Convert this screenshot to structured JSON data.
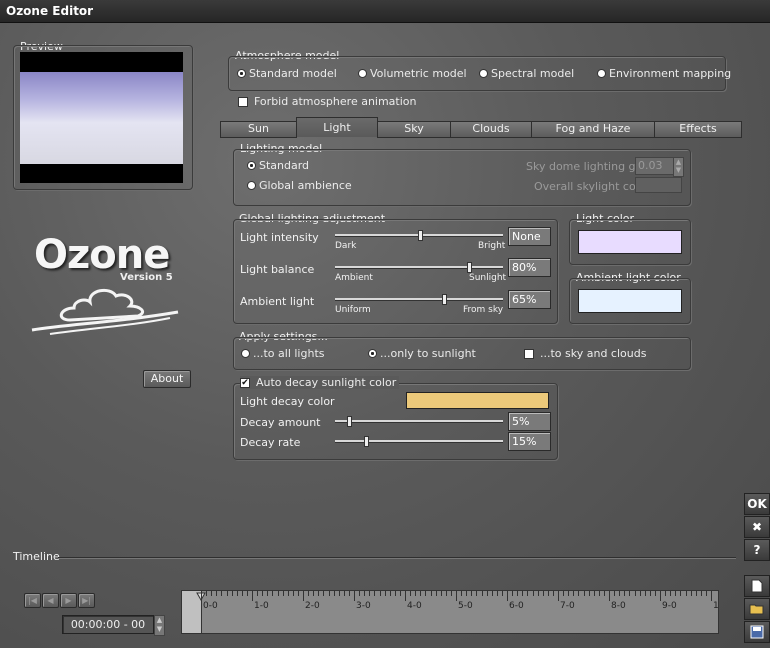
{
  "window": {
    "title": "Ozone Editor"
  },
  "preview": {
    "label": "Preview"
  },
  "logo": {
    "name": "Ozone",
    "version": "Version 5"
  },
  "about_label": "About",
  "atmosphere": {
    "label": "Atmosphere model",
    "options": [
      "Standard model",
      "Volumetric model",
      "Spectral model",
      "Environment mapping"
    ],
    "selected": 0,
    "forbid_label": "Forbid atmosphere animation",
    "forbid_checked": false
  },
  "tabs": [
    "Sun",
    "Light",
    "Sky",
    "Clouds",
    "Fog and Haze",
    "Effects"
  ],
  "active_tab": 1,
  "lighting_model": {
    "label": "Lighting model",
    "options": [
      "Standard",
      "Global ambience"
    ],
    "selected": 0,
    "sky_gain_label": "Sky dome lighting gain",
    "sky_gain_value": "0.03",
    "overall_skylight_label": "Overall skylight color"
  },
  "global_lighting": {
    "label": "Global lighting adjustment",
    "rows": [
      {
        "label": "Light intensity",
        "min_label": "Dark",
        "max_label": "Bright",
        "value": "None",
        "level": 0.5
      },
      {
        "label": "Light balance",
        "min_label": "Ambient",
        "max_label": "Sunlight",
        "value": "80%",
        "level": 0.8
      },
      {
        "label": "Ambient light",
        "min_label": "Uniform",
        "max_label": "From sky",
        "value": "65%",
        "level": 0.65
      }
    ]
  },
  "light_color": {
    "label": "Light color",
    "color": "#e8dcff"
  },
  "ambient_color": {
    "label": "Ambient light color",
    "color": "#e6f2ff"
  },
  "apply": {
    "label": "Apply settings...",
    "options": [
      "...to all lights",
      "...only to sunlight",
      "...to sky and clouds"
    ],
    "selected": 1
  },
  "decay": {
    "auto_label": "Auto decay sunlight color",
    "auto_checked": true,
    "color_label": "Light decay color",
    "color": "#ecc97a",
    "amount_label": "Decay amount",
    "amount_value": "5%",
    "amount_level": 0.05,
    "rate_label": "Decay rate",
    "rate_value": "15%",
    "rate_level": 0.15
  },
  "side_buttons": {
    "ok": "OK",
    "close": "✖",
    "help": "?"
  },
  "timeline": {
    "label": "Timeline",
    "time": "00:00:00 - 00",
    "ticks": [
      "0-0",
      "1-0",
      "2-0",
      "3-0",
      "4-0",
      "5-0",
      "6-0",
      "7-0",
      "8-0",
      "9-0",
      "1"
    ]
  }
}
